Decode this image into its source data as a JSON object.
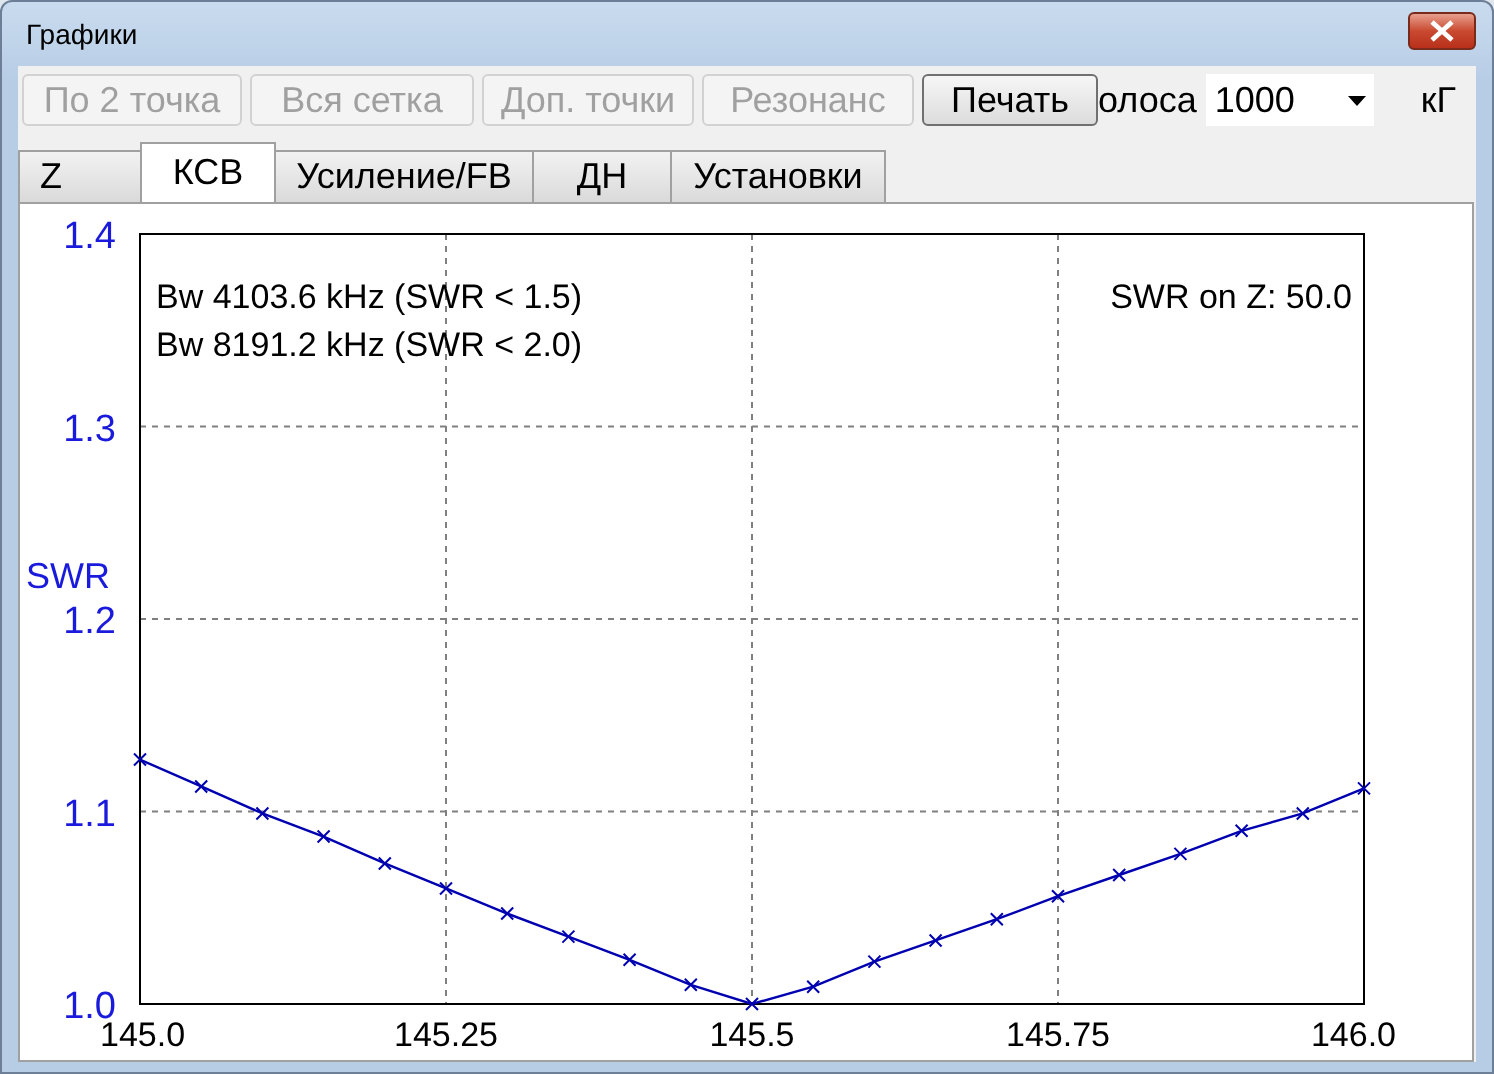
{
  "window": {
    "title": "Графики"
  },
  "toolbar": {
    "buttons": [
      {
        "label": "По 2 точка",
        "disabled": true
      },
      {
        "label": "Вся сетка",
        "disabled": true
      },
      {
        "label": "Доп. точки",
        "disabled": true
      },
      {
        "label": "Резонанс",
        "disabled": true
      },
      {
        "label": "Печать",
        "disabled": false
      }
    ],
    "band_label": "олоса",
    "band_select": {
      "value": "1000"
    },
    "unit": "кГ"
  },
  "tabs": [
    {
      "label": "Z",
      "selected": false
    },
    {
      "label": "КСВ",
      "selected": true
    },
    {
      "label": "Усиление/FB",
      "selected": false
    },
    {
      "label": "ДН",
      "selected": false
    },
    {
      "label": "Установки",
      "selected": false
    }
  ],
  "chart_data": {
    "type": "line",
    "ylabel": "SWR",
    "x": [
      145.0,
      145.05,
      145.1,
      145.15,
      145.2,
      145.25,
      145.3,
      145.35,
      145.4,
      145.45,
      145.5,
      145.55,
      145.6,
      145.65,
      145.7,
      145.75,
      145.8,
      145.85,
      145.9,
      145.95,
      146.0
    ],
    "grid": true,
    "series": [
      {
        "color": "#0000b0",
        "marker": "x",
        "values": [
          1.127,
          1.113,
          1.099,
          1.087,
          1.073,
          1.06,
          1.047,
          1.035,
          1.023,
          1.01,
          1.0,
          1.009,
          1.022,
          1.033,
          1.044,
          1.056,
          1.067,
          1.078,
          1.09,
          1.099,
          1.112
        ]
      }
    ],
    "xlim": [
      145.0,
      146.0
    ],
    "ylim": [
      1.0,
      1.4
    ],
    "xticks": [
      {
        "value": 145.0,
        "label": "145.0"
      },
      145.25,
      145.5,
      145.75,
      {
        "value": 146.0,
        "label": "146.0"
      }
    ],
    "yticks": [
      {
        "value": 1.0,
        "label": "1.0"
      },
      1.1,
      1.2,
      1.3,
      1.4
    ]
  },
  "chart_notes": {
    "bandwidth_notes": [
      "Bw 4103.6 kHz (SWR < 1.5)",
      "Bw 8191.2 kHz (SWR < 2.0)"
    ],
    "impedance_note": "SWR on Z: 50.0"
  }
}
